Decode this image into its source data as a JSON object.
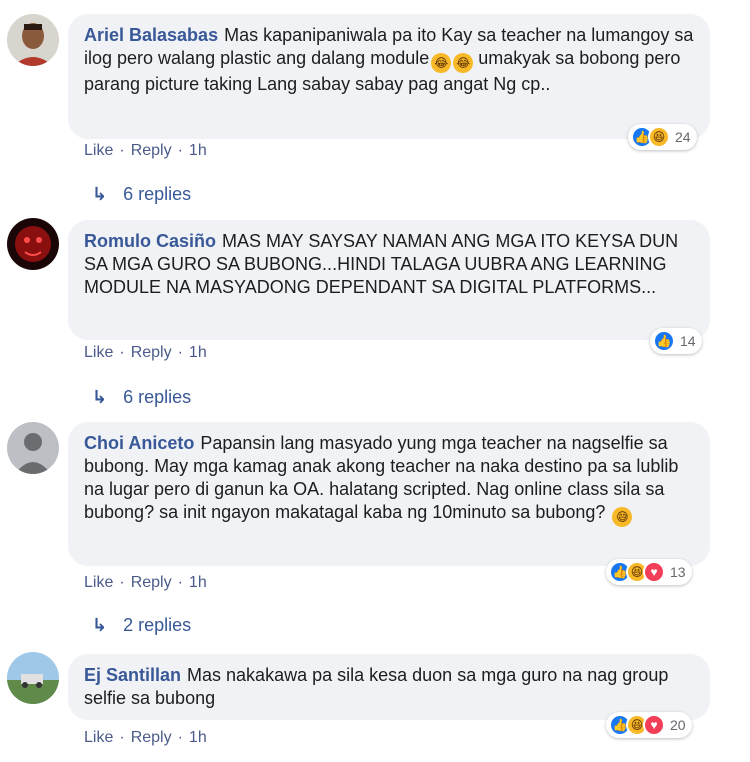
{
  "comments": [
    {
      "author": "Ariel Balasabas",
      "text": "Mas kapanipaniwala pa ito Kay sa teacher na lumangoy sa ilog pero walang plastic ang dalang module",
      "text_after_emoji": "umakyak sa bobong pero parang picture taking Lang sabay sabay pag angat Ng cp..",
      "reaction_count": "24",
      "like": "Like",
      "reply": "Reply",
      "time": "1h",
      "replies": "6 replies"
    },
    {
      "author": "Romulo Casiño",
      "text": "MAS MAY SAYSAY NAMAN ANG MGA ITO KEYSA DUN SA MGA GURO SA BUBONG...HINDI TALAGA UUBRA ANG LEARNING MODULE NA MASYADONG DEPENDANT SA DIGITAL PLATFORMS...",
      "reaction_count": "14",
      "like": "Like",
      "reply": "Reply",
      "time": "1h",
      "replies": "6 replies"
    },
    {
      "author": "Choi Aniceto",
      "text": "Papansin lang masyado yung mga teacher na nagselfie sa bubong. May mga kamag anak akong teacher na naka destino pa sa lublib na lugar pero di ganun ka OA. halatang scripted. Nag online class sila sa bubong? sa init ngayon makatagal kaba ng 10minuto sa bubong?",
      "reaction_count": "13",
      "like": "Like",
      "reply": "Reply",
      "time": "1h",
      "replies": "2 replies"
    },
    {
      "author": "Ej Santillan",
      "text": "Mas nakakawa pa sila kesa duon sa mga guro na nag group selfie sa bubong",
      "reaction_count": "20",
      "like": "Like",
      "reply": "Reply",
      "time": "1h"
    }
  ],
  "icons": {
    "like": "like-reaction-icon",
    "haha": "haha-reaction-icon",
    "love": "love-reaction-icon",
    "reply_arrow": "reply-arrow-icon"
  },
  "colors": {
    "author": "#385898",
    "bubble": "#f0f2f5",
    "like_blue": "#1877f2",
    "haha_yellow": "#f7b928",
    "love_red": "#f33e58"
  }
}
